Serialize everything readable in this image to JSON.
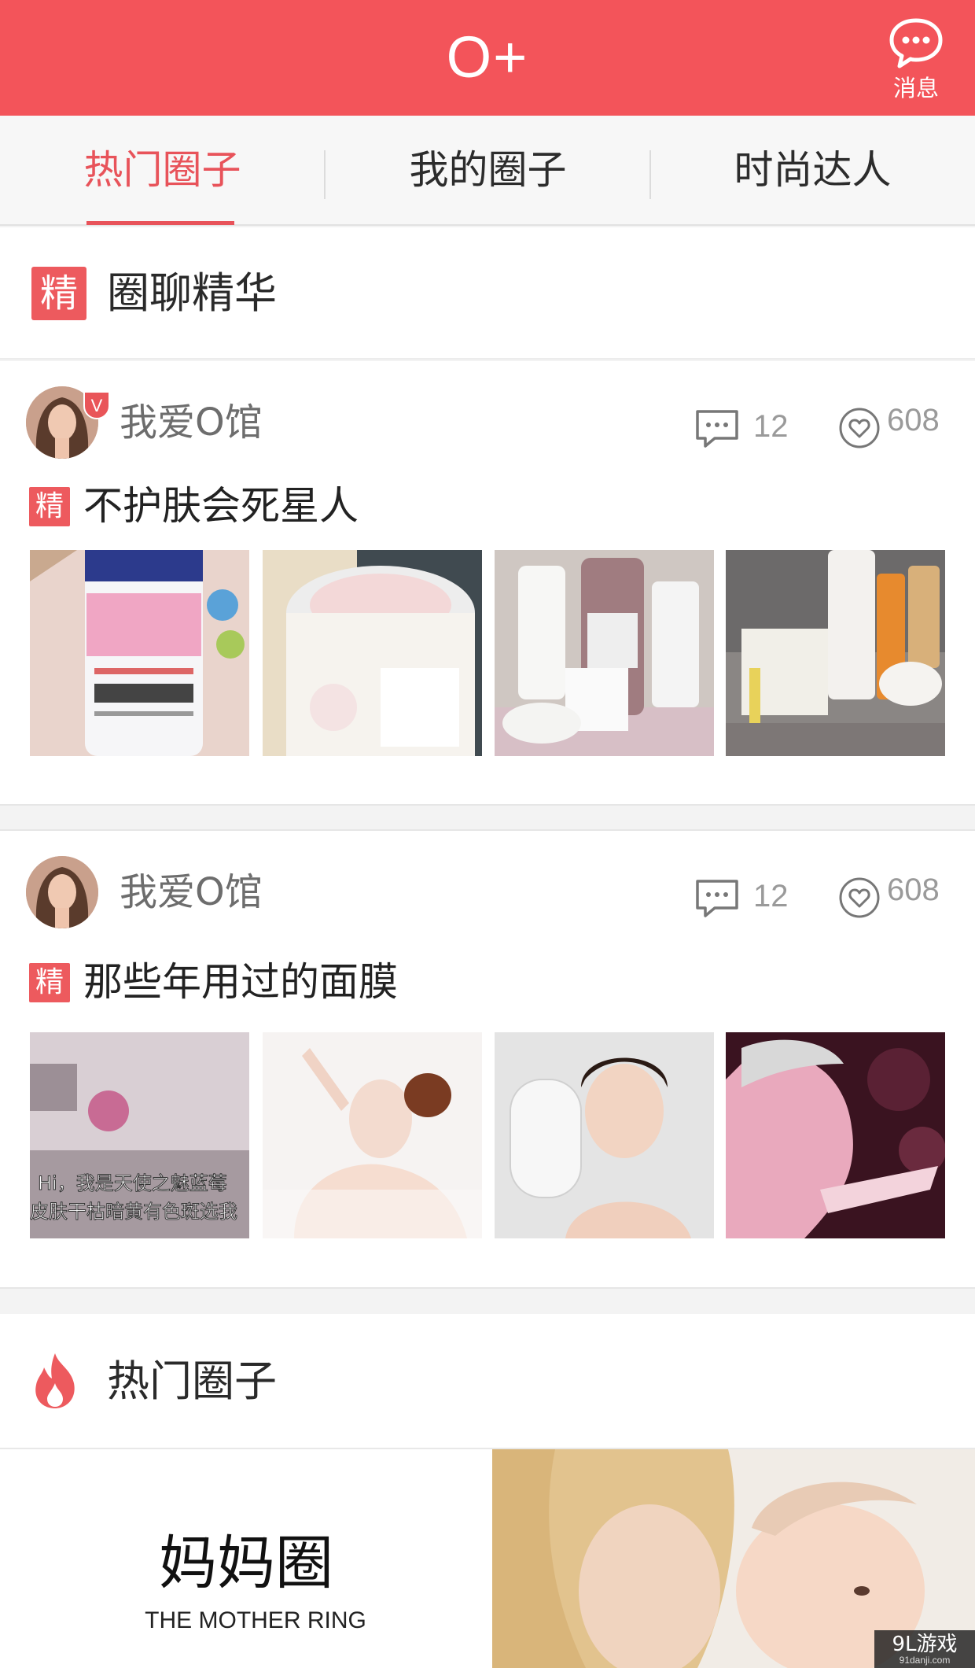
{
  "header": {
    "title": "O+",
    "message_label": "消息"
  },
  "tabs": [
    {
      "label": "热门圈子",
      "active": true
    },
    {
      "label": "我的圈子",
      "active": false
    },
    {
      "label": "时尚达人",
      "active": false
    }
  ],
  "featured_section": {
    "badge": "精",
    "title": "圈聊精华"
  },
  "posts": [
    {
      "author": "我爱O馆",
      "verified": true,
      "verified_badge": "V",
      "comments": "12",
      "likes": "608",
      "badge": "精",
      "title": "不护肤会死星人",
      "images": [
        "skincare-toner-tube",
        "facial-cream-jar",
        "kiehls-products",
        "caudalie-cream-set"
      ]
    },
    {
      "author": "我爱O馆",
      "verified": false,
      "comments": "12",
      "likes": "608",
      "badge": "精",
      "title": "那些年用过的面膜",
      "images": [
        "mask-package-with-text",
        "woman-applying-mask",
        "woman-holding-sheet-mask",
        "woman-peeling-mask"
      ],
      "image_caption_line1": "Hi，我是天使之魅蓝莓",
      "image_caption_line2": "皮肤干枯暗黄有色斑选我"
    }
  ],
  "hot_section": {
    "icon": "flame-icon",
    "title": "热门圈子"
  },
  "banner": {
    "title": "妈妈圈",
    "subtitle": "THE MOTHER RING"
  },
  "watermark": {
    "main": "9L游戏",
    "sub": "91danji.com"
  },
  "colors": {
    "brand": "#f3545a",
    "accent": "#e8535a",
    "badge": "#ed5a5e"
  }
}
